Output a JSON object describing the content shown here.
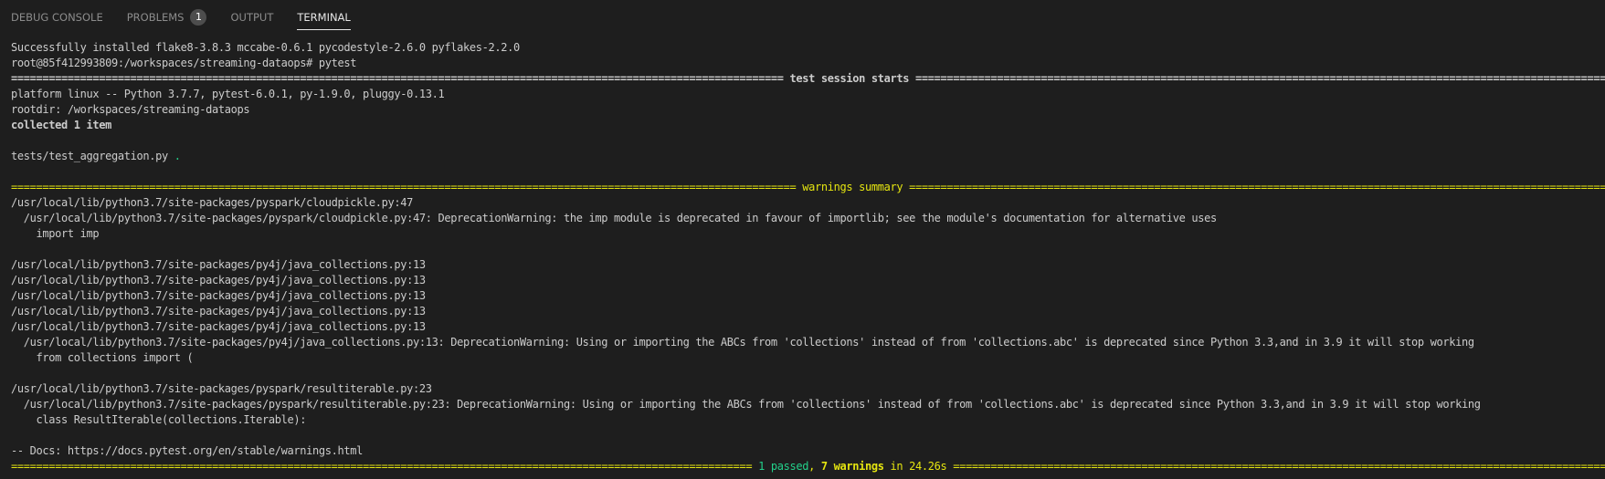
{
  "tabs": [
    {
      "label": "DEBUG CONSOLE",
      "active": false
    },
    {
      "label": "PROBLEMS",
      "active": false,
      "badge": "1"
    },
    {
      "label": "OUTPUT",
      "active": false
    },
    {
      "label": "TERMINAL",
      "active": true
    }
  ],
  "terminal": {
    "install_line": "Successfully installed flake8-3.8.3 mccabe-0.6.1 pycodestyle-2.6.0 pyflakes-2.2.0",
    "prompt_line": "root@85f412993809:/workspaces/streaming-dataops# pytest",
    "session_sep_left": "=========================================================================================================================== ",
    "session_title": "test session starts",
    "session_sep_right": " ===============================================================================================================================",
    "platform_line": "platform linux -- Python 3.7.7, pytest-6.0.1, py-1.9.0, pluggy-0.13.1",
    "rootdir_line": "rootdir: /workspaces/streaming-dataops",
    "collected_line": "collected 1 item",
    "test_file": "tests/test_aggregation.py ",
    "test_result": ".",
    "warn_sep_left": "============================================================================================================================= ",
    "warn_title": "warnings summary",
    "warn_sep_right": " =============================================================================================================================",
    "warnings": {
      "cloudpickle_path": "/usr/local/lib/python3.7/site-packages/pyspark/cloudpickle.py:47",
      "cloudpickle_msg": "  /usr/local/lib/python3.7/site-packages/pyspark/cloudpickle.py:47: DeprecationWarning: the imp module is deprecated in favour of importlib; see the module's documentation for alternative uses",
      "cloudpickle_code": "    import imp",
      "java_paths": [
        "/usr/local/lib/python3.7/site-packages/py4j/java_collections.py:13",
        "/usr/local/lib/python3.7/site-packages/py4j/java_collections.py:13",
        "/usr/local/lib/python3.7/site-packages/py4j/java_collections.py:13",
        "/usr/local/lib/python3.7/site-packages/py4j/java_collections.py:13",
        "/usr/local/lib/python3.7/site-packages/py4j/java_collections.py:13"
      ],
      "java_msg": "  /usr/local/lib/python3.7/site-packages/py4j/java_collections.py:13: DeprecationWarning: Using or importing the ABCs from 'collections' instead of from 'collections.abc' is deprecated since Python 3.3,and in 3.9 it will stop working",
      "java_code": "    from collections import (",
      "result_path": "/usr/local/lib/python3.7/site-packages/pyspark/resultiterable.py:23",
      "result_msg": "  /usr/local/lib/python3.7/site-packages/pyspark/resultiterable.py:23: DeprecationWarning: Using or importing the ABCs from 'collections' instead of from 'collections.abc' is deprecated since Python 3.3,and in 3.9 it will stop working",
      "result_code": "    class ResultIterable(collections.Iterable):"
    },
    "docs_line": "-- Docs: https://docs.pytest.org/en/stable/warnings.html",
    "summary": {
      "sep_left": "====================================================================================================================== ",
      "passed": "1 passed",
      "comma": ", ",
      "warnings": "7 warnings",
      "time": " in 24.26s",
      "sep_right": " ======================================================================================================================"
    }
  },
  "colors": {
    "background": "#1e1e1e",
    "text": "#cccccc",
    "success": "#23d18b",
    "warning": "#e5e510"
  }
}
